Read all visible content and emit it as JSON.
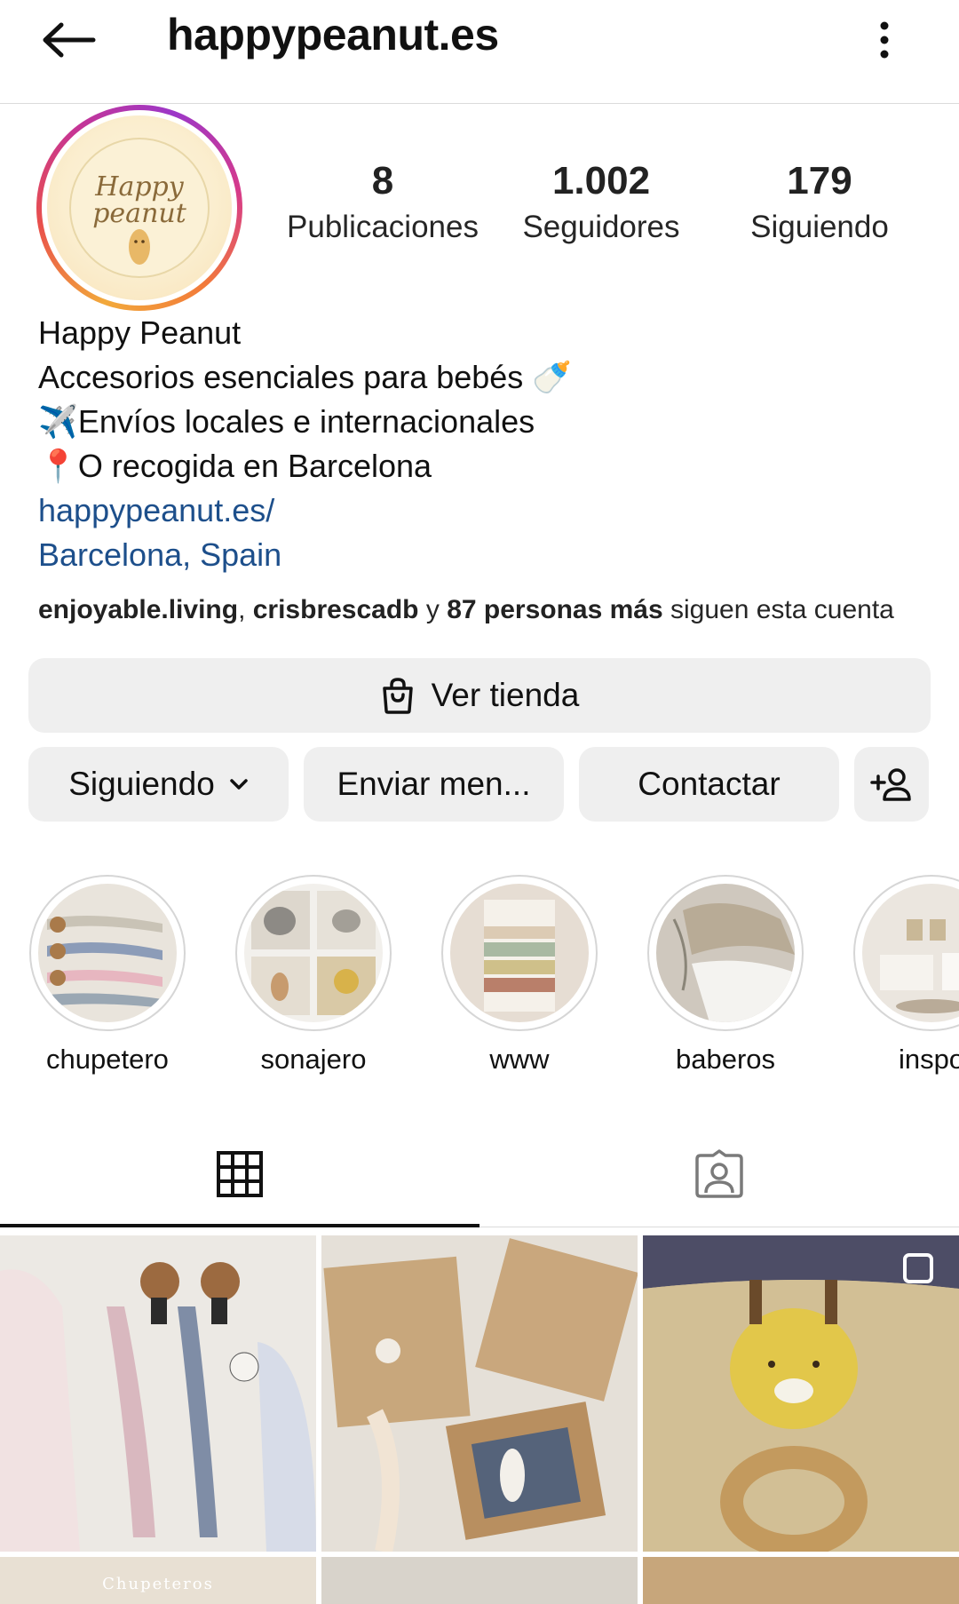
{
  "header": {
    "username": "happypeanut.es",
    "back_icon": "arrow-left-icon",
    "more_icon": "more-vertical-icon"
  },
  "profile": {
    "avatar_text": "Happy peanut",
    "stats": [
      {
        "value": "8",
        "label": "Publicaciones"
      },
      {
        "value": "1.002",
        "label": "Seguidores"
      },
      {
        "value": "179",
        "label": "Siguiendo"
      }
    ]
  },
  "bio": {
    "name": "Happy Peanut",
    "line1": "Accesorios esenciales para bebés 🍼",
    "line2": "✈️Envíos locales e internacionales",
    "line3": "📍O recogida en Barcelona",
    "website": "happypeanut.es/",
    "location": "Barcelona, Spain"
  },
  "followed_by": {
    "user1": "enjoyable.living",
    "sep": ", ",
    "user2": "crisbrescadb",
    "and": " y ",
    "others": "87 personas más",
    "suffix": " siguen esta cuenta"
  },
  "buttons": {
    "shop": "Ver tienda",
    "following": "Siguiendo",
    "message": "Enviar men...",
    "contact": "Contactar"
  },
  "highlights": [
    {
      "label": "chupetero"
    },
    {
      "label": "sonajero"
    },
    {
      "label": "www"
    },
    {
      "label": "baberos"
    },
    {
      "label": "inspo"
    }
  ],
  "grid_labels": {
    "cell4": "Chupeteros"
  },
  "colors": {
    "link": "#1d4f8b",
    "button_bg": "#efefef"
  }
}
